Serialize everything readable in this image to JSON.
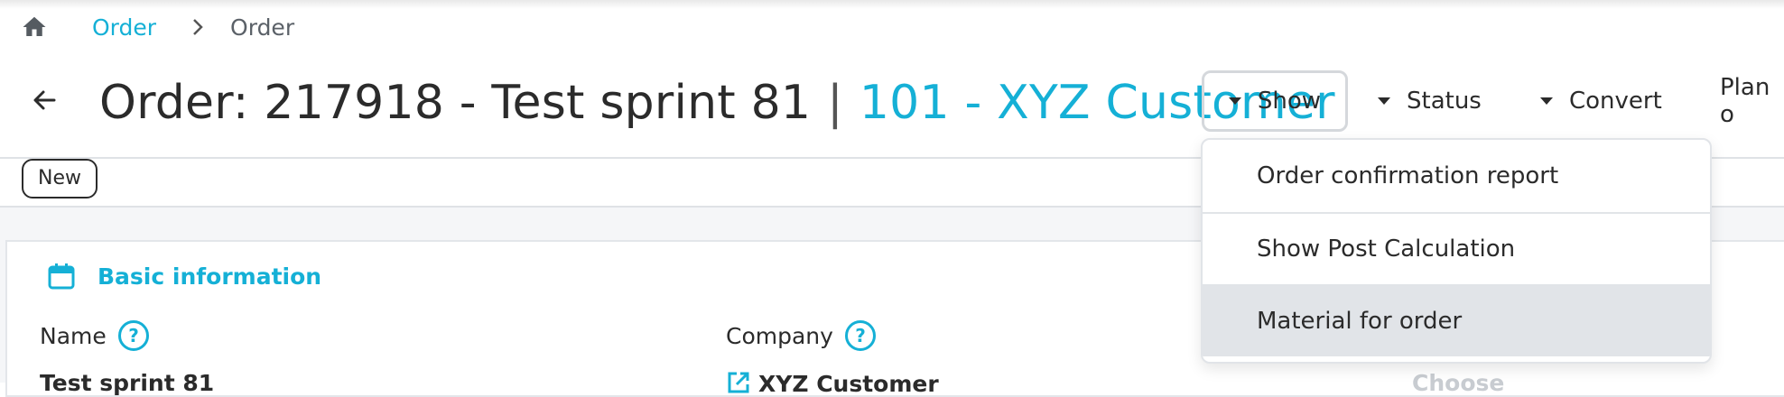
{
  "breadcrumb": {
    "items": [
      "Order",
      "Order"
    ]
  },
  "header": {
    "title": "Order: 217918 - Test sprint 81",
    "separator": "|",
    "customer": "101 - XYZ Customer"
  },
  "actions": {
    "show": "Show",
    "status": "Status",
    "convert": "Convert",
    "plan": "Plan o"
  },
  "status_badge": "New",
  "card": {
    "title": "Basic information",
    "fields": [
      {
        "label": "Name",
        "value": "Test sprint 81"
      },
      {
        "label": "Company",
        "value": "XYZ Customer"
      }
    ],
    "third_value": "Choose"
  },
  "dropdown": {
    "items": [
      "Order confirmation report",
      "Show Post Calculation",
      "Material for order"
    ],
    "active_index": 2
  },
  "colors": {
    "accent": "#15b0d6",
    "text": "#2b2b2b",
    "border": "#dfe2e6",
    "hover": "#e1e4e8"
  }
}
